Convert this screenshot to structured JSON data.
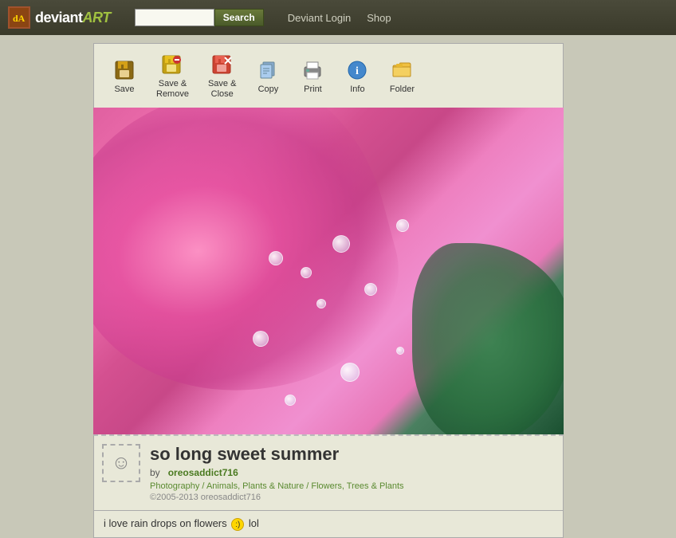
{
  "header": {
    "logo_text_deviant": "deviant",
    "logo_text_art": "ART",
    "search_placeholder": "",
    "search_button_label": "Search",
    "nav": {
      "login_label": "Deviant Login",
      "shop_label": "Shop"
    }
  },
  "toolbar": {
    "save_label": "Save",
    "save_remove_label": "Save &\nRemove",
    "save_close_label": "Save &\nClose",
    "copy_label": "Copy",
    "print_label": "Print",
    "info_label": "Info",
    "folder_label": "Folder"
  },
  "artwork": {
    "title": "so long sweet summer",
    "artist": "oreosaddict716",
    "by_text": "by",
    "categories": "Photography / Animals, Plants & Nature / Flowers, Trees & Plants",
    "copyright": "©2005-2013 oreosaddict716",
    "category_nature": "Nature"
  },
  "comment": {
    "text_before": "i love rain drops on flowers",
    "text_after": "lol"
  }
}
